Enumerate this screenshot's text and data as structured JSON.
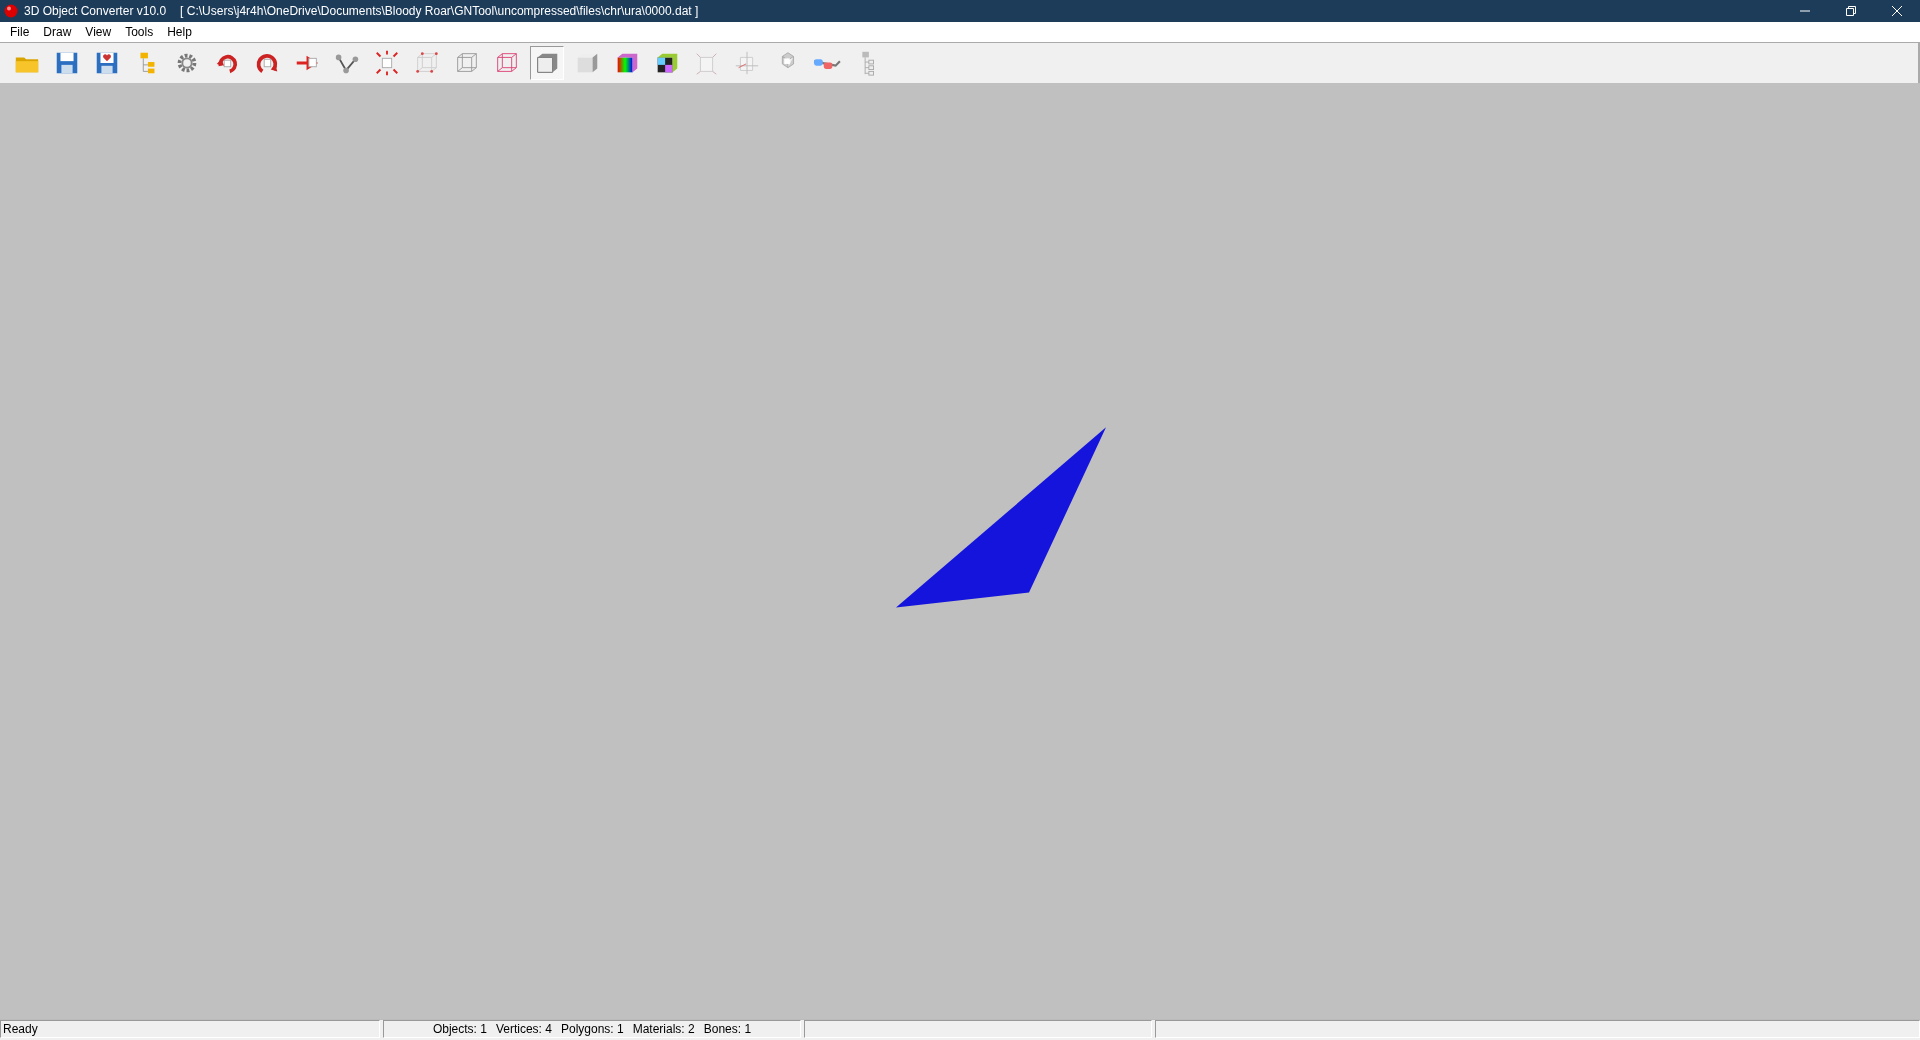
{
  "window": {
    "title": "3D Object Converter v10.0",
    "path": "[ C:\\Users\\j4r4h\\OneDrive\\Documents\\Bloody Roar\\GNTool\\uncompressed\\files\\chr\\ura\\0000.dat ]"
  },
  "menu": [
    "File",
    "Draw",
    "View",
    "Tools",
    "Help"
  ],
  "toolbar": [
    {
      "kind": "open",
      "selected": false
    },
    {
      "kind": "save",
      "selected": false
    },
    {
      "kind": "savefav",
      "selected": false
    },
    {
      "kind": "tree",
      "selected": false
    },
    {
      "kind": "gear",
      "selected": false
    },
    {
      "kind": "rotate",
      "selected": false
    },
    {
      "kind": "spin",
      "selected": false
    },
    {
      "kind": "move",
      "selected": false
    },
    {
      "kind": "bones",
      "selected": false
    },
    {
      "kind": "explode",
      "selected": false
    },
    {
      "kind": "points",
      "selected": false
    },
    {
      "kind": "wire",
      "selected": false
    },
    {
      "kind": "wirered",
      "selected": false
    },
    {
      "kind": "flat",
      "selected": true
    },
    {
      "kind": "smooth",
      "selected": false
    },
    {
      "kind": "color",
      "selected": false
    },
    {
      "kind": "texture",
      "selected": false
    },
    {
      "kind": "normals",
      "selected": false
    },
    {
      "kind": "axes",
      "selected": false
    },
    {
      "kind": "unwrap",
      "selected": false
    },
    {
      "kind": "glasses",
      "selected": false
    },
    {
      "kind": "hierarchy",
      "selected": false
    }
  ],
  "status_bar": {
    "message": "Ready",
    "stats": [
      "Objects: 1",
      "Vertices: 4",
      "Polygons: 1",
      "Materials: 2",
      "Bones: 1"
    ]
  }
}
